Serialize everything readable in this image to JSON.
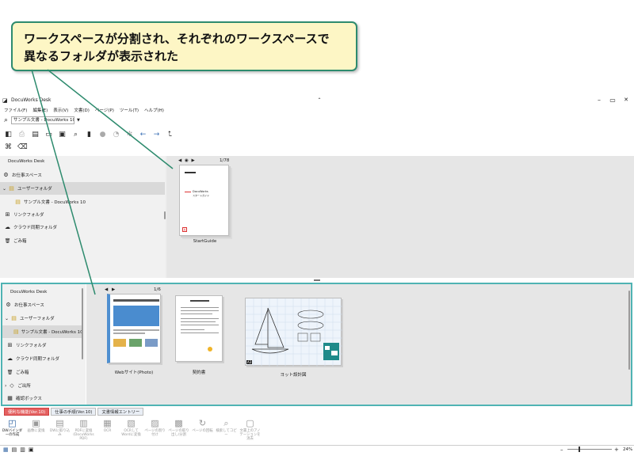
{
  "callout": {
    "line1": "ワークスペースが分割され、それぞれのワークスペースで",
    "line2": "異なるフォルダが表示された"
  },
  "window": {
    "title": "DocuWorks Desk",
    "min_glyph": "–",
    "max_glyph": "▭",
    "close_glyph": "✕",
    "restore_glyph": "⌃"
  },
  "menu": [
    "ファイル(F)",
    "編集(E)",
    "表示(V)",
    "文書(D)",
    "ページ(P)",
    "ツール(T)",
    "ヘルプ(H)"
  ],
  "address": {
    "value": "サンプル文書 - DocuWorks 10体験",
    "search_icon": "search-icon"
  },
  "top_sidebar": {
    "header": "DocuWorks Desk",
    "items": [
      {
        "label": "お仕事スペース",
        "icon": "⚙"
      },
      {
        "label": "ユーザーフォルダ",
        "icon": "▤",
        "expand": "⌄"
      },
      {
        "label": "サンプル文書 - DocuWorks 10",
        "icon": "▤"
      },
      {
        "label": "リンクフォルダ",
        "icon": "⊞"
      },
      {
        "label": "クラウド同期フォルダ",
        "icon": "☁"
      },
      {
        "label": "ごみ箱",
        "icon": "🗑"
      }
    ]
  },
  "top_content": {
    "doc_label": "StartGuide",
    "page_nav": "1/78",
    "nav_prev": "◀",
    "nav_next": "▶",
    "cover_title": "DocuWorks",
    "cover_sub": "スタートガイド",
    "badge": "A"
  },
  "bottom_sidebar": {
    "header": "DocuWorks Desk",
    "items": [
      {
        "label": "お仕事スペース",
        "icon": "⚙"
      },
      {
        "label": "ユーザーフォルダ",
        "icon": "▤",
        "expand": "⌄"
      },
      {
        "label": "サンプル文書 - DocuWorks 10",
        "icon": "▤",
        "selected": true
      },
      {
        "label": "リンクフォルダ",
        "icon": "⊞"
      },
      {
        "label": "クラウド同期フォルダ",
        "icon": "☁"
      },
      {
        "label": "ごみ箱",
        "icon": "🗑"
      },
      {
        "label": "ご出所",
        "icon": "◇",
        "expand": "›"
      },
      {
        "label": "確認ボックス",
        "icon": "▦"
      }
    ]
  },
  "bottom_content": {
    "docs": [
      {
        "label": "Webサイト(Photo)",
        "page_nav": "1/6",
        "nav_prev": "◀",
        "nav_next": "▶"
      },
      {
        "label": "契約書"
      },
      {
        "label": "ヨット設計図",
        "badge": "A3"
      }
    ]
  },
  "tabs": [
    {
      "label": "便利な機能(Ver.10)",
      "style": "red"
    },
    {
      "label": "仕事の手順(Ver.10)",
      "style": "gray"
    },
    {
      "label": "文書情報エントリー",
      "style": "gray"
    }
  ],
  "bottom_toolbar": [
    {
      "label": "DWバインダーの作成",
      "icon": "◰",
      "on": true
    },
    {
      "label": "画像に変換",
      "icon": "▣"
    },
    {
      "label": "DWに取り込み",
      "icon": "▤"
    },
    {
      "label": "PDFに変換(DocuWorks PDF)",
      "icon": "▥"
    },
    {
      "label": "OCR",
      "icon": "▦"
    },
    {
      "label": "OCRしてWordに変換",
      "icon": "▧"
    },
    {
      "label": "ページの割り付け",
      "icon": "▨"
    },
    {
      "label": "ページの取り出し/分割",
      "icon": "▩"
    },
    {
      "label": "ページの回転",
      "icon": "↻"
    },
    {
      "label": "検索してコピー",
      "icon": "⌕"
    },
    {
      "label": "文書上のアノテーションを消去",
      "icon": "▢"
    }
  ],
  "status": {
    "zoom": "24%",
    "minus": "–",
    "plus": "+"
  }
}
